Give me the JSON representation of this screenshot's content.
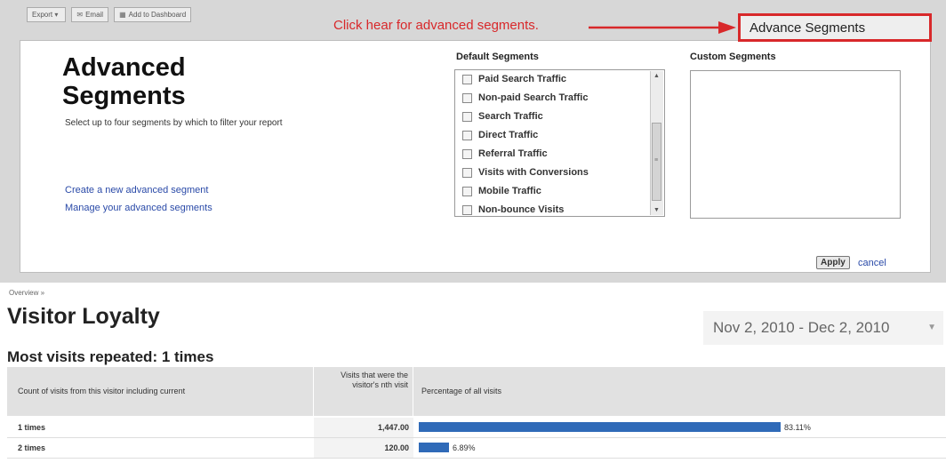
{
  "toolbar": {
    "export": "Export",
    "email": "Email",
    "add_dashboard": "Add to Dashboard"
  },
  "annotation": {
    "text": "Click hear for advanced segments.",
    "button_label": "Advance Segments",
    "accent_color": "#d8282a"
  },
  "panel": {
    "title": "Advanced Segments",
    "subtitle": "Select up to four segments by which to filter your report",
    "link_create": "Create a new advanced segment",
    "link_manage": "Manage your advanced segments",
    "default_heading": "Default Segments",
    "custom_heading": "Custom Segments",
    "default_segments": [
      "Paid Search Traffic",
      "Non-paid Search Traffic",
      "Search Traffic",
      "Direct Traffic",
      "Referral Traffic",
      "Visits with Conversions",
      "Mobile Traffic",
      "Non-bounce Visits"
    ],
    "apply_label": "Apply",
    "cancel_label": "cancel"
  },
  "report": {
    "breadcrumb": "Overview »",
    "title": "Visitor Loyalty",
    "date_range": "Nov 2, 2010 - Dec 2, 2010",
    "subheading": "Most visits repeated: 1 times",
    "columns": [
      "Count of visits from this visitor including current",
      "Visits that were the visitor's nth visit",
      "Percentage of all visits"
    ],
    "rows": [
      {
        "label": "1 times",
        "visits": "1,447.00",
        "percent": "83.11%",
        "fraction": 0.8311
      },
      {
        "label": "2 times",
        "visits": "120.00",
        "percent": "6.89%",
        "fraction": 0.0689
      }
    ],
    "bar_color": "#2f6ab8"
  }
}
